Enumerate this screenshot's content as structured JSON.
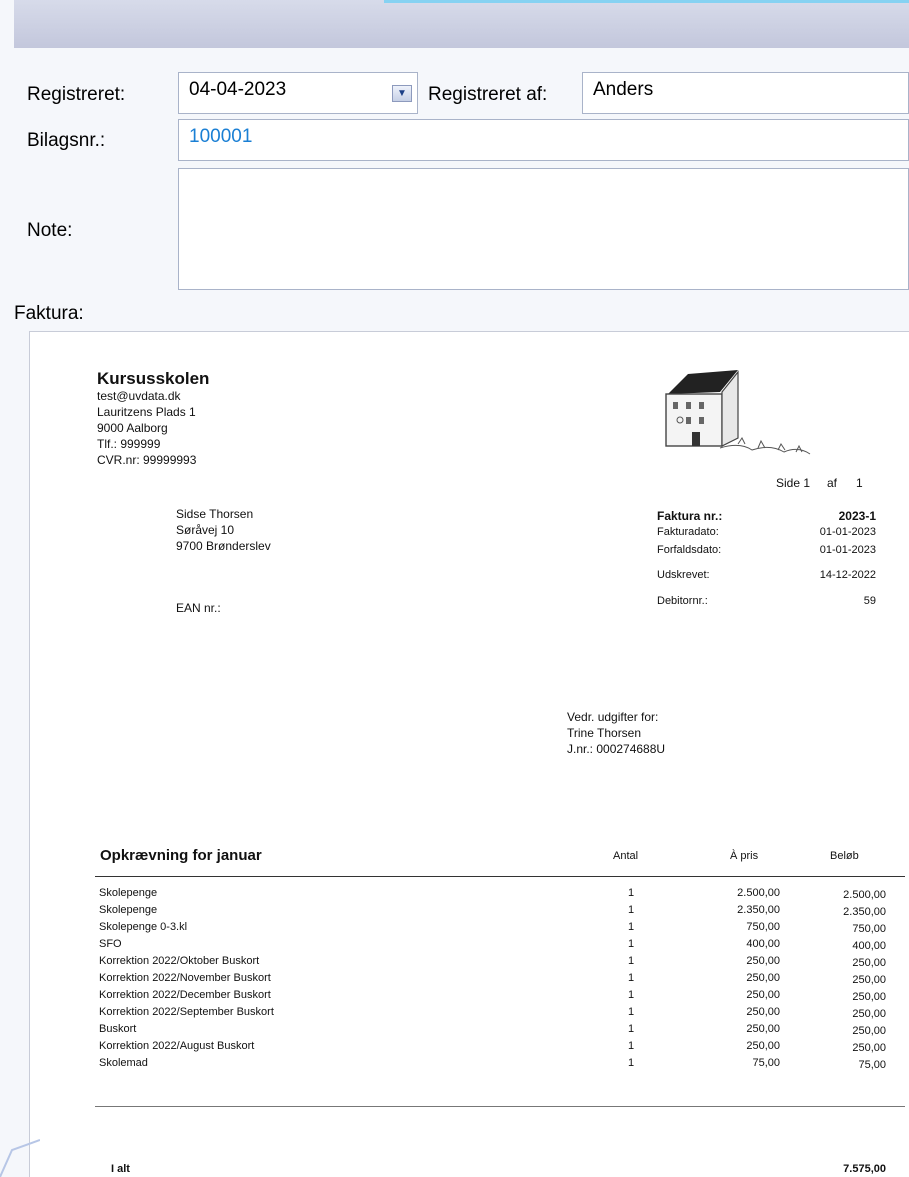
{
  "form": {
    "registered_label": "Registreret:",
    "registered_value": "04-04-2023",
    "registered_by_label": "Registreret af:",
    "registered_by_value": "Anders",
    "voucher_label": "Bilagsnr.:",
    "voucher_value": "100001",
    "note_label": "Note:",
    "note_value": "",
    "invoice_label": "Faktura:"
  },
  "invoice": {
    "company": {
      "name": "Kursusskolen",
      "email": "test@uvdata.dk",
      "address": "Lauritzens Plads 1",
      "city": "9000 Aalborg",
      "phone": "Tlf.: 999999",
      "cvr": "CVR.nr: 99999993"
    },
    "page": {
      "side": "Side 1",
      "af": "af",
      "total": "1"
    },
    "recipient": {
      "name": "Sidse Thorsen",
      "street": "Søråvej 10",
      "city": "9700 Brønderslev",
      "ean": "EAN nr.:"
    },
    "meta": [
      {
        "label": "Faktura nr.:",
        "value": "2023-1",
        "bold": true
      },
      {
        "label": "Fakturadato:",
        "value": "01-01-2023",
        "bold": false
      },
      {
        "label": "Forfaldsdato:",
        "value": "01-01-2023",
        "bold": false
      },
      {
        "label": "Udskrevet:",
        "value": "14-12-2022",
        "bold": false
      },
      {
        "label": "Debitornr.:",
        "value": "59",
        "bold": false
      }
    ],
    "regarding": {
      "line1": "Vedr. udgifter for:",
      "line2": "Trine Thorsen",
      "line3": "J.nr.: 000274688U"
    },
    "table": {
      "title": "Opkrævning for januar",
      "col_qty": "Antal",
      "col_price": "À pris",
      "col_amount": "Beløb",
      "rows": [
        {
          "desc": "Skolepenge",
          "qty": "1",
          "price": "2.500,00",
          "amount": "2.500,00"
        },
        {
          "desc": "Skolepenge",
          "qty": "1",
          "price": "2.350,00",
          "amount": "2.350,00"
        },
        {
          "desc": "Skolepenge 0-3.kl",
          "qty": "1",
          "price": "750,00",
          "amount": "750,00"
        },
        {
          "desc": "SFO",
          "qty": "1",
          "price": "400,00",
          "amount": "400,00"
        },
        {
          "desc": "Korrektion 2022/Oktober Buskort",
          "qty": "1",
          "price": "250,00",
          "amount": "250,00"
        },
        {
          "desc": "Korrektion 2022/November Buskort",
          "qty": "1",
          "price": "250,00",
          "amount": "250,00"
        },
        {
          "desc": "Korrektion 2022/December Buskort",
          "qty": "1",
          "price": "250,00",
          "amount": "250,00"
        },
        {
          "desc": "Korrektion 2022/September Buskort",
          "qty": "1",
          "price": "250,00",
          "amount": "250,00"
        },
        {
          "desc": "Buskort",
          "qty": "1",
          "price": "250,00",
          "amount": "250,00"
        },
        {
          "desc": "Korrektion 2022/August Buskort",
          "qty": "1",
          "price": "250,00",
          "amount": "250,00"
        },
        {
          "desc": "Skolemad",
          "qty": "1",
          "price": "75,00",
          "amount": "75,00"
        }
      ],
      "total_label": "I alt",
      "total_value": "7.575,00"
    }
  },
  "icons": {
    "dropdown": "chevron-down-icon",
    "logo": "school-building-logo"
  },
  "colors": {
    "voucher_text": "#1a7fd4",
    "header_band": "#c3c7dc",
    "field_border": "#a9b3c9"
  }
}
